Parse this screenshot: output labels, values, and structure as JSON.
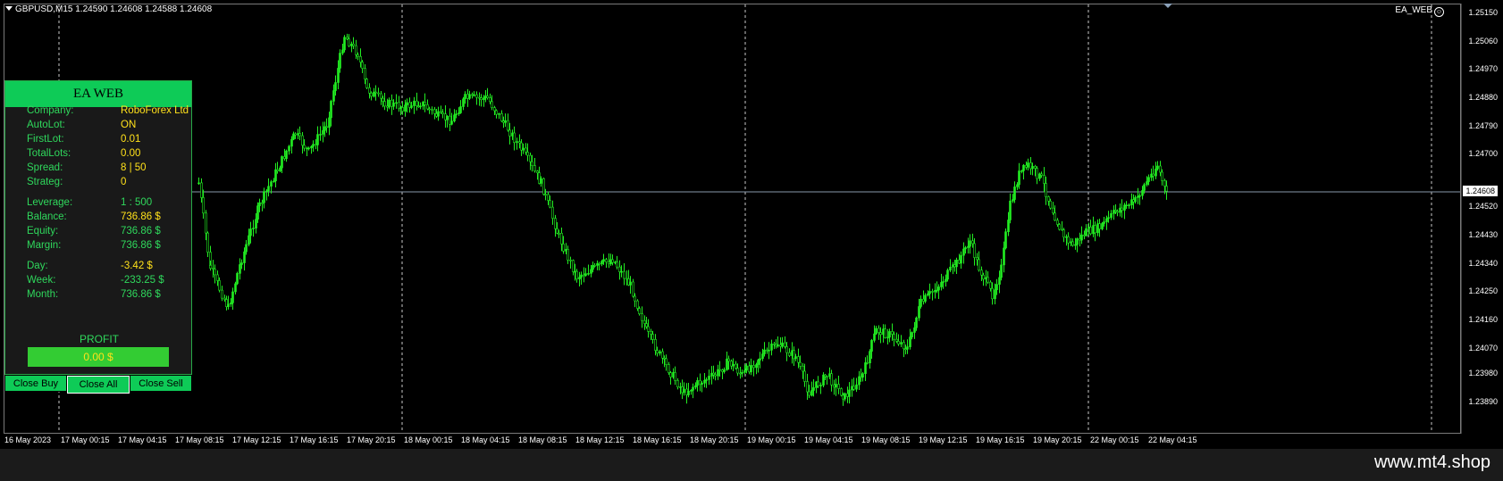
{
  "header": {
    "symbol_line": "GBPUSD,M15  1.24590 1.24608 1.24588 1.24608"
  },
  "ea_tag": {
    "label": "EA_WEB"
  },
  "price_axis": {
    "ticks": [
      "1.25150",
      "1.25060",
      "1.24970",
      "1.24880",
      "1.24790",
      "1.24700",
      "1.24520",
      "1.24430",
      "1.24340",
      "1.24250",
      "1.24160",
      "1.24070",
      "1.23980",
      "1.23890"
    ],
    "current": "1.24608"
  },
  "time_axis": {
    "ticks": [
      "16 May 2023",
      "17 May 00:15",
      "17 May 04:15",
      "17 May 08:15",
      "17 May 12:15",
      "17 May 16:15",
      "17 May 20:15",
      "18 May 00:15",
      "18 May 04:15",
      "18 May 08:15",
      "18 May 12:15",
      "18 May 16:15",
      "18 May 20:15",
      "19 May 00:15",
      "19 May 04:15",
      "19 May 08:15",
      "19 May 12:15",
      "19 May 16:15",
      "19 May 20:15",
      "22 May 00:15",
      "22 May 04:15"
    ]
  },
  "panel": {
    "title": "EA WEB",
    "rows": [
      {
        "label": "Company:",
        "value": "RoboForex Ltd"
      },
      {
        "label": "AutoLot:",
        "value": "ON"
      },
      {
        "label": "FirstLot:",
        "value": "0.01"
      },
      {
        "label": "TotalLots:",
        "value": "0.00"
      },
      {
        "label": "Spread:",
        "value": "8  |  50"
      },
      {
        "label": "Strateg:",
        "value": "0"
      },
      {
        "label": "Leverage:",
        "value": "1 : 500"
      },
      {
        "label": "Balance:",
        "value": "736.86 $"
      },
      {
        "label": "Equity:",
        "value": "736.86 $"
      },
      {
        "label": "Margin:",
        "value": "736.86 $"
      },
      {
        "label": "Day:",
        "value": "-3.42 $"
      },
      {
        "label": "Week:",
        "value": "-233.25 $"
      },
      {
        "label": "Month:",
        "value": "736.86 $"
      }
    ],
    "profit_label": "PROFIT",
    "profit_value": "0.00 $"
  },
  "buttons": {
    "close_buy": "Close Buy",
    "close_all": "Close All",
    "close_sell": "Close Sell"
  },
  "watermark": "www.mt4.shop",
  "colors": {
    "candle": "#22ee22",
    "panel_accent": "#0ecb57",
    "value_highlight": "#ffe11a"
  }
}
